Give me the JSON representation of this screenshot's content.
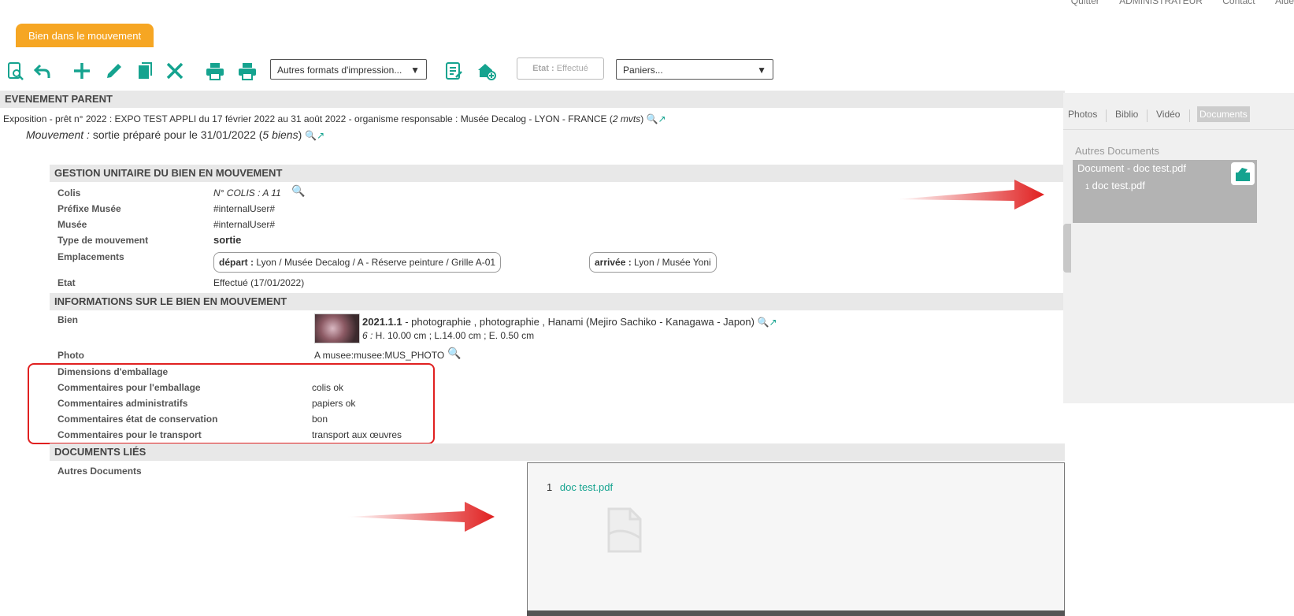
{
  "topnav": {
    "items": [
      "Quitter",
      "ADMINISTRATEUR",
      "Contact",
      "Aide"
    ]
  },
  "tab": {
    "label": "Bien dans le mouvement"
  },
  "toolbar": {
    "print_formats": "Autres formats d'impression...",
    "etat_label": "Etat :",
    "etat_value": "Effectué",
    "paniers": "Paniers..."
  },
  "parent": {
    "header": "EVENEMENT PARENT",
    "expo_text": "Exposition - prêt n° 2022 : EXPO TEST APPLI du 17 février 2022 au 31 août 2022 - organisme responsable : Musée Decalog - LYON - FRANCE (",
    "expo_count": "2 mvts",
    "expo_close": ")",
    "mouvement_label": "Mouvement :",
    "mouvement_text": "sortie préparé pour le 31/01/2022 (",
    "mouvement_count": "5 biens",
    "mouvement_close": ")"
  },
  "gestion": {
    "header": "GESTION UNITAIRE DU BIEN EN MOUVEMENT",
    "colis_label": "Colis",
    "colis_value": "N° COLIS :  A 11",
    "prefixe_label": "Préfixe Musée",
    "prefixe_value": "#internalUser#",
    "musee_label": "Musée",
    "musee_value": "#internalUser#",
    "type_label": "Type de mouvement",
    "type_value": "sortie",
    "emplacements_label": "Emplacements",
    "depart_label": "départ :",
    "depart_value": "Lyon / Musée Decalog / A - Réserve peinture / Grille A-01",
    "arrivee_label": "arrivée :",
    "arrivee_value": "Lyon / Musée Yoni",
    "etat_label": "Etat",
    "etat_value": "Effectué (17/01/2022)"
  },
  "informations": {
    "header": "INFORMATIONS SUR LE BIEN EN MOUVEMENT",
    "bien_label": "Bien",
    "bien_number": "2021.1.1",
    "bien_desc": " - photographie , photographie , Hanami (Mejiro Sachiko - Kanagawa - Japon)",
    "bien_dim_prefix": "6 :",
    "bien_dims": " H. 10.00 cm ; L.14.00 cm ; E. 0.50 cm",
    "photo_label": "Photo",
    "photo_value": "A musee:musee:MUS_PHOTO",
    "dim_emb_label": "Dimensions d'emballage",
    "comm_emb_label": "Commentaires pour l'emballage",
    "comm_emb_value": "colis ok",
    "comm_admin_label": "Commentaires administratifs",
    "comm_admin_value": "papiers ok",
    "comm_etat_label": "Commentaires état de conservation",
    "comm_etat_value": "bon",
    "comm_transport_label": "Commentaires pour le transport",
    "comm_transport_value": "transport aux œuvres"
  },
  "documents": {
    "header": "DOCUMENTS LIÉS",
    "autres_label": "Autres Documents",
    "viewer_index": "1",
    "viewer_link": "doc test.pdf"
  },
  "sidebar": {
    "tabs": [
      "Photos",
      "Biblio",
      "Vidéo",
      "Documents"
    ],
    "active_tab": "Documents",
    "section_title": "Autres Documents",
    "card_title": "Document - doc test.pdf",
    "card_index": "1",
    "card_file": "doc test.pdf"
  },
  "colors": {
    "accent": "#15a38f",
    "tab_orange": "#f6a623",
    "highlight_red": "#e02020"
  }
}
